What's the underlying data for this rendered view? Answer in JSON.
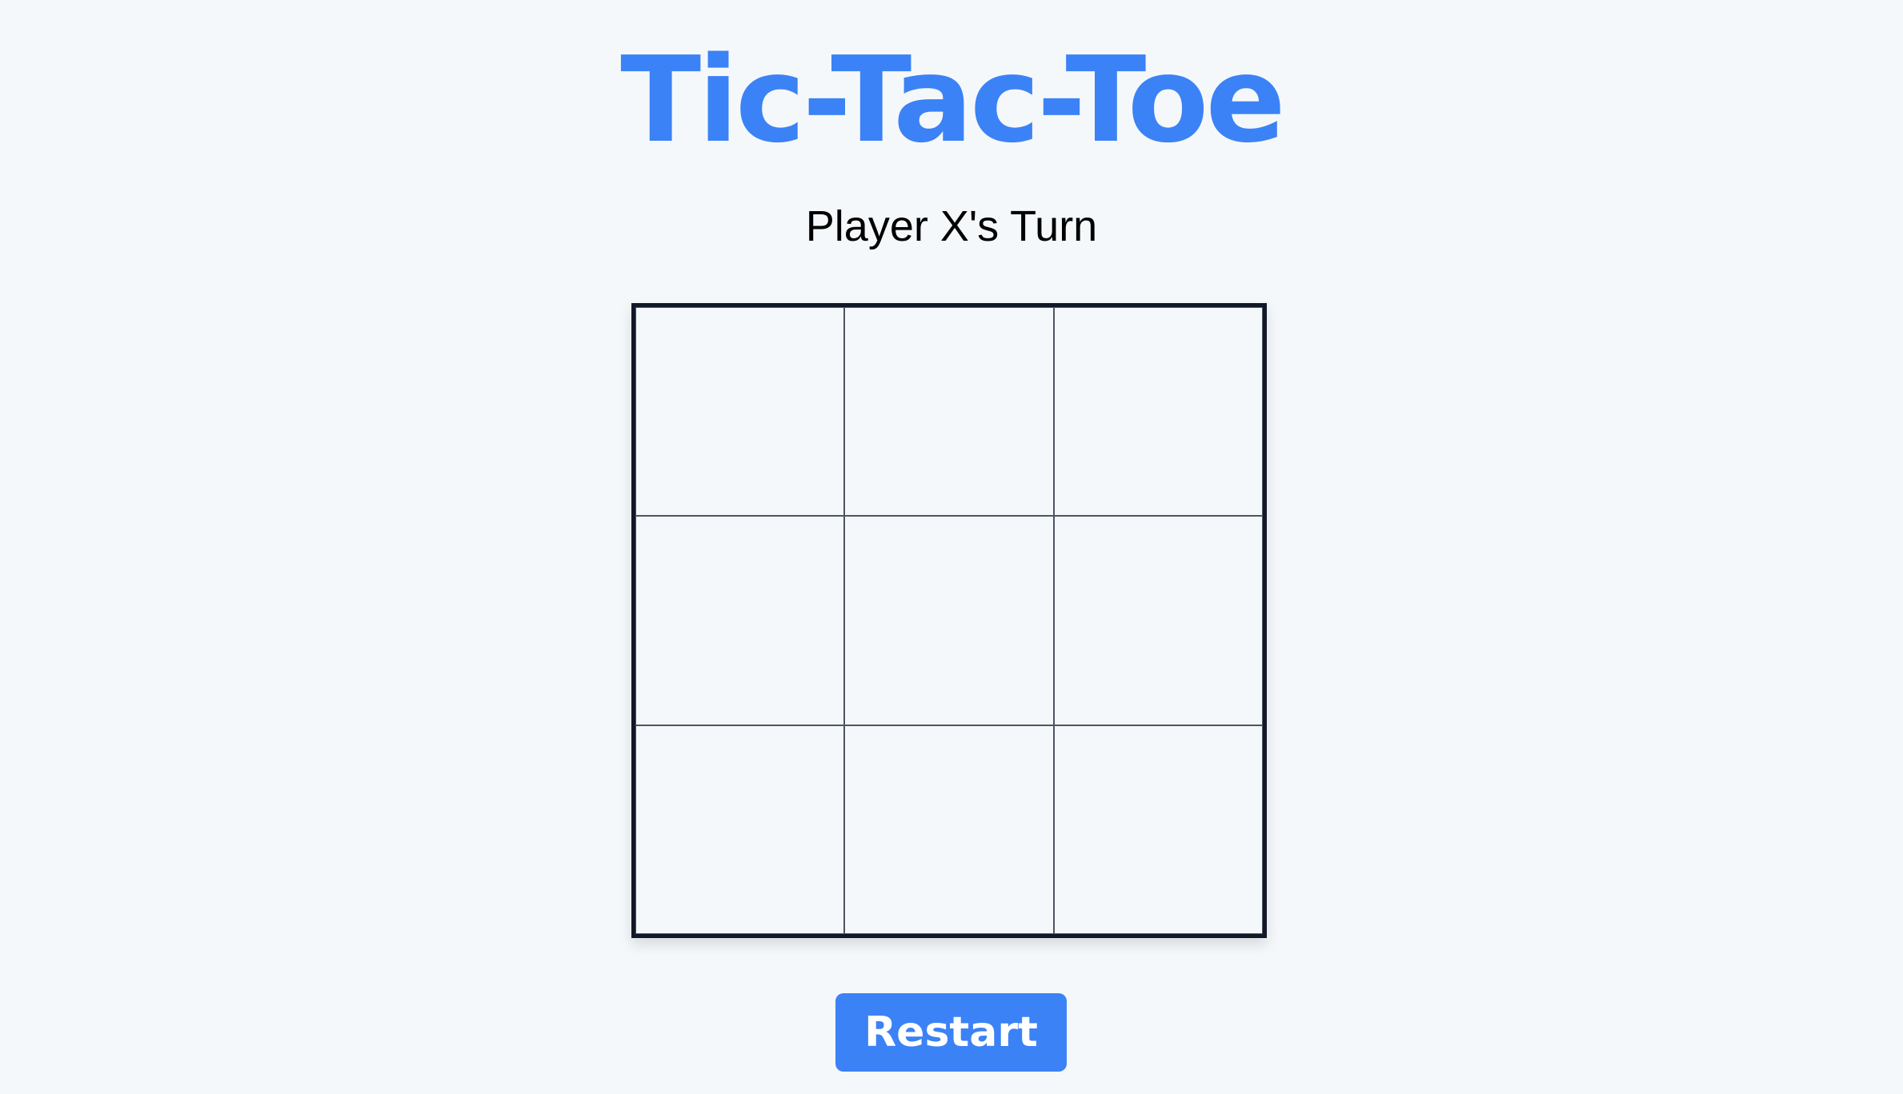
{
  "header": {
    "title": "Tic-Tac-Toe"
  },
  "status": {
    "text": "Player X's Turn"
  },
  "board": {
    "cells": [
      "",
      "",
      "",
      "",
      "",
      "",
      "",
      "",
      ""
    ]
  },
  "controls": {
    "restart_label": "Restart"
  },
  "colors": {
    "accent": "#3b82f6",
    "background": "#f5f8fb",
    "board_border": "#111827",
    "grid_line": "#4b5563",
    "status_text": "#000000",
    "button_text": "#ffffff"
  }
}
